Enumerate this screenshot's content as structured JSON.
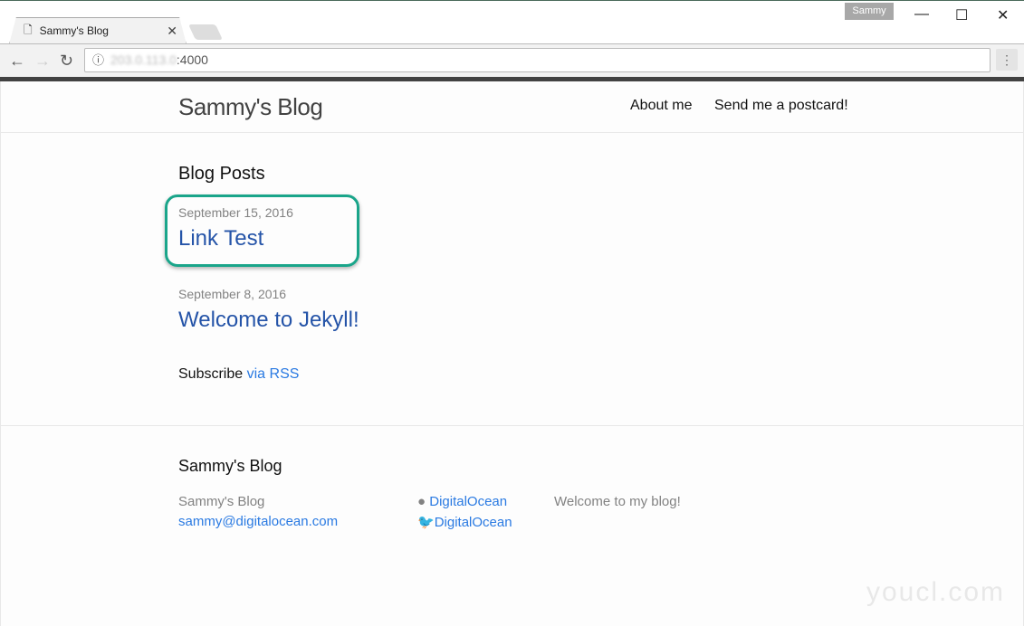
{
  "browser": {
    "tab_title": "Sammy's Blog",
    "profile": "Sammy",
    "url_host": "203.0.113.0",
    "url_port": ":4000"
  },
  "site": {
    "title": "Sammy's Blog",
    "nav": [
      "About me",
      "Send me a postcard!"
    ]
  },
  "main": {
    "heading": "Blog Posts",
    "posts": [
      {
        "date": "September 15, 2016",
        "title": "Link Test"
      },
      {
        "date": "September 8, 2016",
        "title": "Welcome to Jekyll!"
      }
    ],
    "subscribe": "Subscribe",
    "rss": "via RSS"
  },
  "footer": {
    "heading": "Sammy's Blog",
    "name": "Sammy's Blog",
    "email": "sammy@digitalocean.com",
    "github": "DigitalOcean",
    "twitter": "DigitalOcean",
    "description": "Welcome to my blog!"
  },
  "watermark": "youcl.com",
  "colors": {
    "highlight": "#1aa58a",
    "link": "#2a7ae2"
  }
}
